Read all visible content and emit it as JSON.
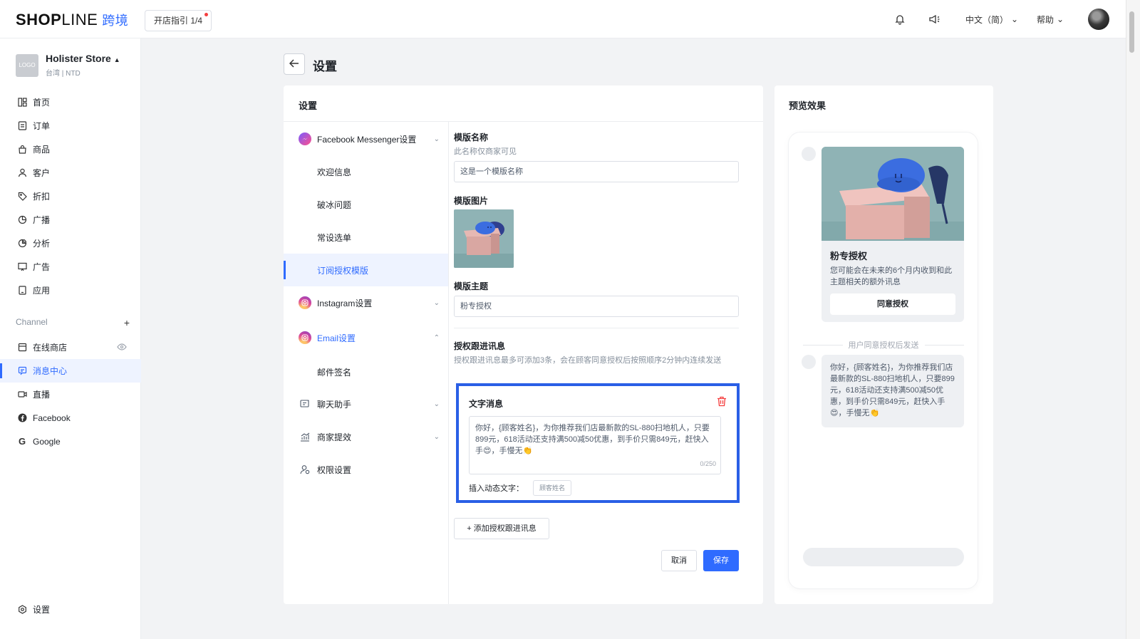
{
  "topbar": {
    "logo_main": "SHOP",
    "logo_light": "LINE",
    "logo_sub": "跨境",
    "guide_label": "开店指引 1/4",
    "language": "中文（简）",
    "help": "帮助",
    "icons": [
      "bell-icon",
      "megaphone-icon",
      "chevron-down-icon",
      "avatar"
    ]
  },
  "sidebar": {
    "store_logo": "LOGO",
    "store_name": "Holister Store",
    "store_sub": "台湾 | NTD",
    "items": [
      {
        "label": "首页",
        "icon": "home-icon"
      },
      {
        "label": "订单",
        "icon": "orders-icon"
      },
      {
        "label": "商品",
        "icon": "bag-icon"
      },
      {
        "label": "客户",
        "icon": "user-icon"
      },
      {
        "label": "折扣",
        "icon": "tag-icon"
      },
      {
        "label": "广播",
        "icon": "broadcast-icon"
      },
      {
        "label": "分析",
        "icon": "chart-icon"
      },
      {
        "label": "广告",
        "icon": "ads-icon"
      },
      {
        "label": "应用",
        "icon": "apps-icon"
      }
    ],
    "channel_title": "Channel",
    "channel_add": "+",
    "channels": [
      {
        "label": "在线商店",
        "icon": "store-icon"
      },
      {
        "label": "消息中心",
        "icon": "message-icon"
      },
      {
        "label": "直播",
        "icon": "live-icon"
      },
      {
        "label": "Facebook",
        "icon": "facebook-icon"
      },
      {
        "label": "Google",
        "icon": "google-icon"
      }
    ],
    "settings": "设置"
  },
  "page": {
    "title": "设置",
    "card_title": "设置"
  },
  "subnav": {
    "messenger": "Facebook Messenger设置",
    "messenger_children": [
      "欢迎信息",
      "破冰问题",
      "常设选单",
      "订阅授权模版"
    ],
    "instagram": "Instagram设置",
    "email": "Email设置",
    "email_children": [
      "邮件签名"
    ],
    "chat": "聊天助手",
    "efficiency": "商家提效",
    "permission": "权限设置"
  },
  "form": {
    "name_label": "模版名称",
    "name_hint": "此名称仅商家可见",
    "name_value": "这是一个模版名称",
    "image_label": "模版图片",
    "topic_label": "模版主题",
    "topic_value": "粉专授权",
    "follow_label": "授权跟进讯息",
    "follow_hint": "授权跟进讯息最多可添加3条，会在顾客同意授权后按照顺序2分钟内连续发送",
    "msg_title": "文字消息",
    "msg_text": "你好，{顾客姓名}，为你推荐我们店最新款的SL-880扫地机人，只要899元，618活动还支持满500减50优惠，到手价只需849元，赶快入手😍，手慢无👏",
    "counter": "0/250",
    "insert_label": "插入动态文字：",
    "chip": "顾客姓名",
    "add_follow": "+ 添加授权跟进讯息",
    "cancel": "取消",
    "save": "保存"
  },
  "preview": {
    "title": "预览效果",
    "card_title": "粉专授权",
    "card_desc": "您可能会在未来的6个月内收到和此主题相关的额外讯息",
    "card_button": "同意授权",
    "separator": "用户同意授权后发送",
    "bubble": "你好，{顾客姓名}，为你推荐我们店最新款的SL-880扫地机人，只要899元，618活动还支持满500减50优惠，到手价只需849元，赶快入手😍，手慢无👏"
  }
}
